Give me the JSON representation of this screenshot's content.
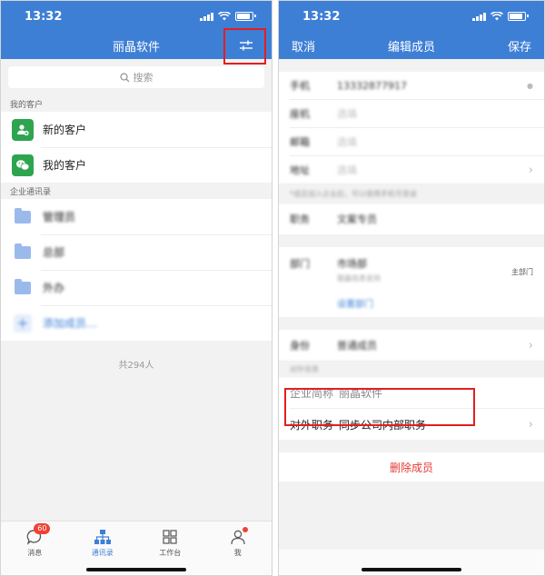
{
  "left": {
    "status": {
      "time": "13:32"
    },
    "nav": {
      "title": "丽晶软件"
    },
    "search": {
      "placeholder": "搜索"
    },
    "section_customers": "我的客户",
    "customers": [
      {
        "label": "新的客户",
        "icon": "add-customer-icon"
      },
      {
        "label": "我的客户",
        "icon": "wechat-icon"
      }
    ],
    "section_directory": "企业通讯录",
    "directory": [
      {
        "label": "管理员"
      },
      {
        "label": "总部"
      },
      {
        "label": "外办"
      }
    ],
    "add_member": "添加成员…",
    "total": "共294人",
    "tabs": [
      {
        "label": "消息",
        "icon": "message-icon",
        "badge": "60"
      },
      {
        "label": "通讯录",
        "icon": "contacts-icon"
      },
      {
        "label": "工作台",
        "icon": "workbench-icon"
      },
      {
        "label": "我",
        "icon": "profile-icon"
      }
    ]
  },
  "right": {
    "status": {
      "time": "13:32"
    },
    "nav": {
      "cancel": "取消",
      "title": "编辑成员",
      "save": "保存"
    },
    "rows": {
      "phone": {
        "label": "手机",
        "value": "13332877917"
      },
      "landline": {
        "label": "座机",
        "value": "选填"
      },
      "email": {
        "label": "邮箱",
        "value": "选填"
      },
      "address": {
        "label": "地址",
        "value": "选填"
      }
    },
    "hint": "*成员加入企业后，可以使用手机号登录",
    "position": {
      "label": "职务",
      "value": "文案专员"
    },
    "department": {
      "label": "部门",
      "value": "市场部",
      "sub": "丽晶信息支持",
      "main_tag": "主部门",
      "set": "设置部门"
    },
    "identity": {
      "label": "身份",
      "value": "普通成员"
    },
    "external_header": "对外信息",
    "company_short": {
      "label": "企业简称",
      "value": "丽晶软件"
    },
    "external_position": {
      "label": "对外职务",
      "value": "同步公司内部职务"
    },
    "delete": "删除成员"
  },
  "colors": {
    "primary": "#3e7fd6",
    "highlight": "#e41e1e",
    "danger": "#e53935",
    "green": "#2ea44f"
  }
}
